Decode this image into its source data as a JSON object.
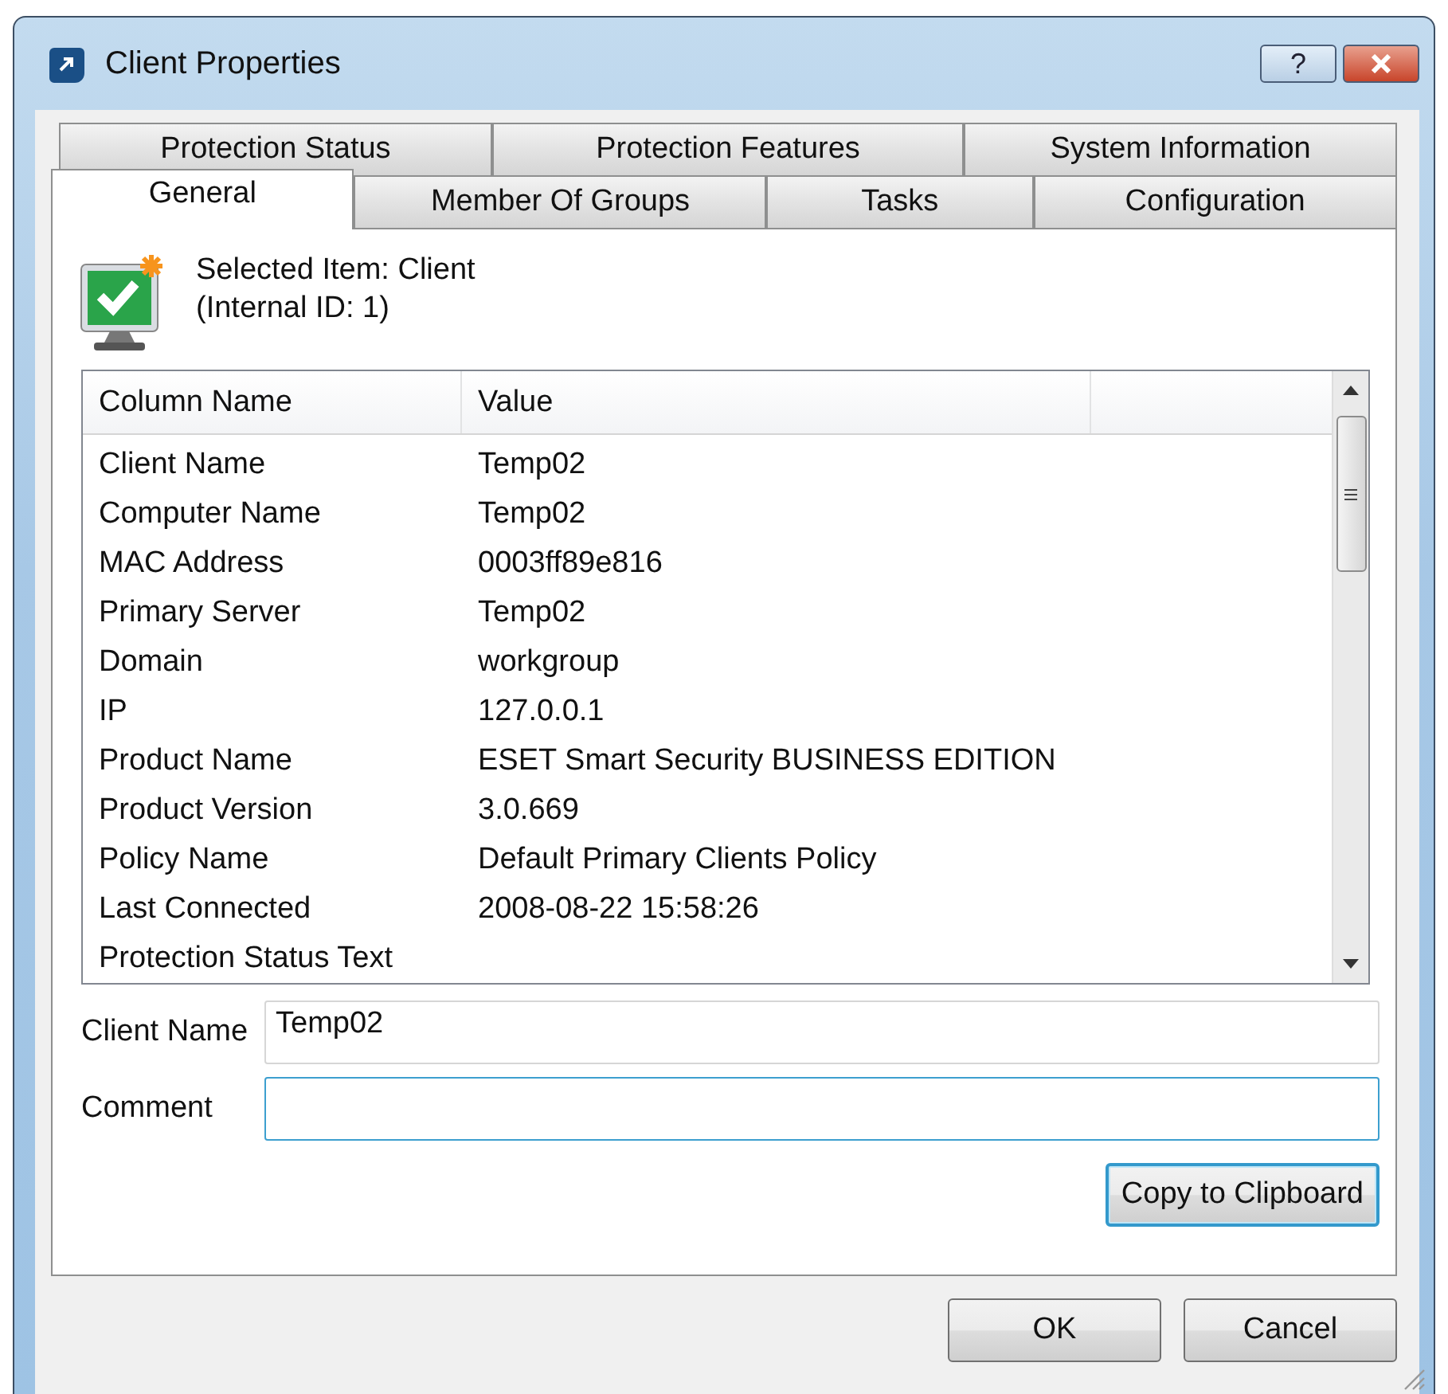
{
  "window": {
    "title": "Client Properties",
    "buttons": [
      {
        "kind": "help",
        "label": "?"
      },
      {
        "kind": "close"
      }
    ]
  },
  "tabs": [
    [
      {
        "label": "Protection Status",
        "selected": false
      },
      {
        "label": "Protection Features",
        "selected": false
      },
      {
        "label": "System Information",
        "selected": false
      }
    ],
    [
      {
        "label": "General",
        "selected": true
      },
      {
        "label": "Member Of Groups",
        "selected": false
      },
      {
        "label": "Tasks",
        "selected": false
      },
      {
        "label": "Configuration",
        "selected": false
      }
    ]
  ],
  "selected_item": {
    "title": "Selected Item: Client",
    "subtitle": "(Internal ID: 1)"
  },
  "table": {
    "columns": [
      "Column Name",
      "Value"
    ],
    "rows": [
      {
        "name": "Client Name",
        "value": "Temp02"
      },
      {
        "name": "Computer Name",
        "value": "Temp02"
      },
      {
        "name": "MAC Address",
        "value": "0003ff89e816"
      },
      {
        "name": "Primary Server",
        "value": "Temp02"
      },
      {
        "name": "Domain",
        "value": "workgroup"
      },
      {
        "name": "IP",
        "value": "127.0.0.1"
      },
      {
        "name": "Product Name",
        "value": "ESET Smart Security BUSINESS EDITION"
      },
      {
        "name": "Product Version",
        "value": "3.0.669"
      },
      {
        "name": "Policy Name",
        "value": "Default Primary Clients Policy"
      },
      {
        "name": "Last Connected",
        "value": "2008-08-22 15:58:26"
      },
      {
        "name": "Protection Status Text"
      }
    ]
  },
  "fields": [
    {
      "label": "Client Name",
      "value": "Temp02",
      "focused": false
    },
    {
      "label": "Comment",
      "focused": true
    }
  ],
  "copy_button": {
    "label": "Copy to Clipboard",
    "focused": true
  },
  "buttons": [
    {
      "label": "OK"
    },
    {
      "label": "Cancel"
    }
  ]
}
